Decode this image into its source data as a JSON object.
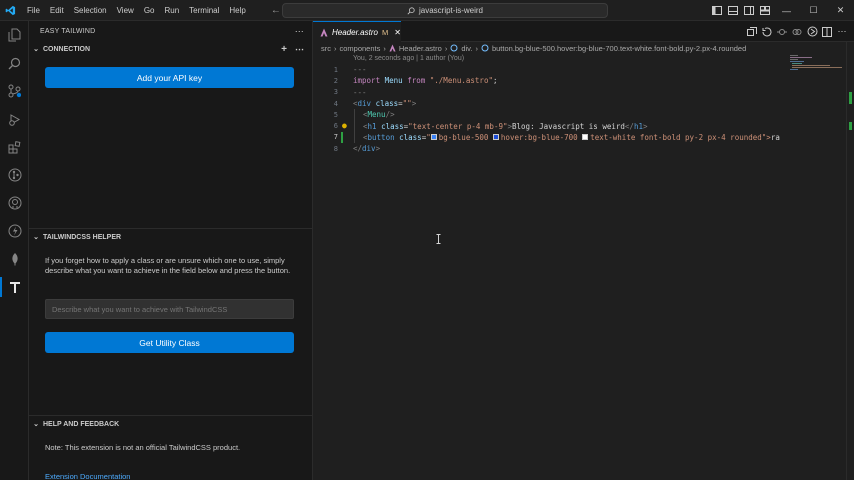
{
  "titlebar": {
    "menu": [
      "File",
      "Edit",
      "Selection",
      "View",
      "Go",
      "Run",
      "Terminal",
      "Help"
    ],
    "search_text": "javascript-is-weird"
  },
  "activity": [
    "explorer-icon",
    "search-icon",
    "source-control-icon",
    "run-debug-icon",
    "extensions-icon",
    "git-graph-icon",
    "github-icon",
    "copilot-icon",
    "mongodb-icon",
    "tailwind-icon"
  ],
  "sidebar": {
    "title": "EASY TAILWIND",
    "connection": {
      "header": "CONNECTION",
      "api_button": "Add your API key"
    },
    "helper": {
      "header": "TAILWINDCSS HELPER",
      "description": "If you forget how to apply a class or are unsure which one to use, simply describe what you want to achieve in the field below and press the button.",
      "placeholder": "Describe what you want to achieve with TailwindCSS",
      "button": "Get Utility Class"
    },
    "feedback": {
      "header": "HELP AND FEEDBACK",
      "note": "Note: This extension is not an official TailwindCSS product.",
      "link": "Extension Documentation"
    }
  },
  "editor": {
    "tab_name": "Header.astro",
    "tab_status": "M",
    "breadcrumb": [
      "src",
      "components",
      "Header.astro",
      "div.",
      "button.bg-blue-500.hover:bg-blue-700.text-white.font-bold.py-2.px-4.rounded"
    ],
    "blame": "You, 2 seconds ago | 1 author (You)",
    "current_line": 7,
    "lines": {
      "n1": "1",
      "n2": "2",
      "n3": "3",
      "n4": "4",
      "n5": "5",
      "n6": "6",
      "n7": "7",
      "n8": "8",
      "l1": "---",
      "l2_kw": "import",
      "l2_var": "Menu",
      "l2_from": "from",
      "l2_str": "\"./Menu.astro\"",
      "l2_end": ";",
      "l3": "---",
      "l4_open": "<",
      "l4_tag": "div",
      "l4_attr": "class",
      "l4_eq": "=",
      "l4_str": "\"\"",
      "l4_close": ">",
      "l5_open": "<",
      "l5_comp": "Menu",
      "l5_close": " />",
      "l6_open": "<",
      "l6_tag": "h1",
      "l6_attr": "class",
      "l6_eq": "=",
      "l6_str": "\"text-center p-4 mb-9\"",
      "l6_gt": ">",
      "l6_text": "Blog: Javascript is weird",
      "l6_end_open": "</",
      "l6_end_tag": "h1",
      "l6_end_close": ">",
      "l7_open": "<",
      "l7_tag": "button",
      "l7_attr": "class",
      "l7_eq": "=",
      "l7_q": "\"",
      "l7_c1": "bg-blue-500",
      "l7_c2": "hover:bg-blue-700",
      "l7_c3": "text-white font-bold py-2 px-4 rounded",
      "l7_tail": "\">",
      "l7_more": "ra",
      "l8_open": "</",
      "l8_tag": "div",
      "l8_close": ">"
    },
    "swatch_colors": {
      "blue500": "#3b82f6",
      "blue700": "#1d4ed8",
      "white": "#ffffff"
    }
  },
  "colors": {
    "accent": "#0078d4",
    "modified": "#e2c08d"
  }
}
